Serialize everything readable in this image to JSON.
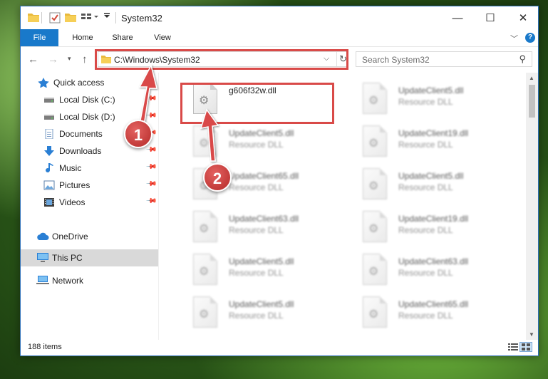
{
  "window": {
    "title": "System32",
    "controls": {
      "minimize": "—",
      "maximize": "☐",
      "close": "✕"
    }
  },
  "ribbon": {
    "tabs": [
      "File",
      "Home",
      "Share",
      "View"
    ]
  },
  "address": {
    "path": "C:\\Windows\\System32"
  },
  "search": {
    "placeholder": "Search System32"
  },
  "sidebar": {
    "items": [
      {
        "label": "Quick access",
        "icon": "star-icon",
        "pinned": false
      },
      {
        "label": "Local Disk (C:)",
        "icon": "drive-icon",
        "pinned": true
      },
      {
        "label": "Local Disk (D:)",
        "icon": "drive-icon",
        "pinned": true
      },
      {
        "label": "Documents",
        "icon": "documents-icon",
        "pinned": true
      },
      {
        "label": "Downloads",
        "icon": "download-icon",
        "pinned": true
      },
      {
        "label": "Music",
        "icon": "music-icon",
        "pinned": true
      },
      {
        "label": "Pictures",
        "icon": "pictures-icon",
        "pinned": true
      },
      {
        "label": "Videos",
        "icon": "videos-icon",
        "pinned": true
      },
      {
        "label": "OneDrive",
        "icon": "cloud-icon",
        "pinned": false
      },
      {
        "label": "This PC",
        "icon": "computer-icon",
        "pinned": false,
        "selected": true
      },
      {
        "label": "Network",
        "icon": "network-icon",
        "pinned": false
      }
    ]
  },
  "files": [
    {
      "name": "g606f32w.dll",
      "type": "",
      "highlighted": true
    },
    {
      "name": "UpdateClient5.dll",
      "type": "Resource DLL"
    },
    {
      "name": "UpdateClient5.dll",
      "type": "Resource DLL"
    },
    {
      "name": "UpdateClient19.dll",
      "type": "Resource DLL"
    },
    {
      "name": "UpdateClient65.dll",
      "type": "Resource DLL"
    },
    {
      "name": "UpdateClient5.dll",
      "type": "Resource DLL"
    },
    {
      "name": "UpdateClient63.dll",
      "type": "Resource DLL"
    },
    {
      "name": "UpdateClient19.dll",
      "type": "Resource DLL"
    },
    {
      "name": "UpdateClient5.dll",
      "type": "Resource DLL"
    },
    {
      "name": "UpdateClient63.dll",
      "type": "Resource DLL"
    },
    {
      "name": "UpdateClient5.dll",
      "type": "Resource DLL"
    },
    {
      "name": "UpdateClient65.dll",
      "type": "Resource DLL"
    }
  ],
  "status": {
    "count": "188 items"
  },
  "annotations": {
    "badge1": "1",
    "badge2": "2"
  },
  "colors": {
    "accent": "#1979ca",
    "highlight": "#d94a48"
  }
}
